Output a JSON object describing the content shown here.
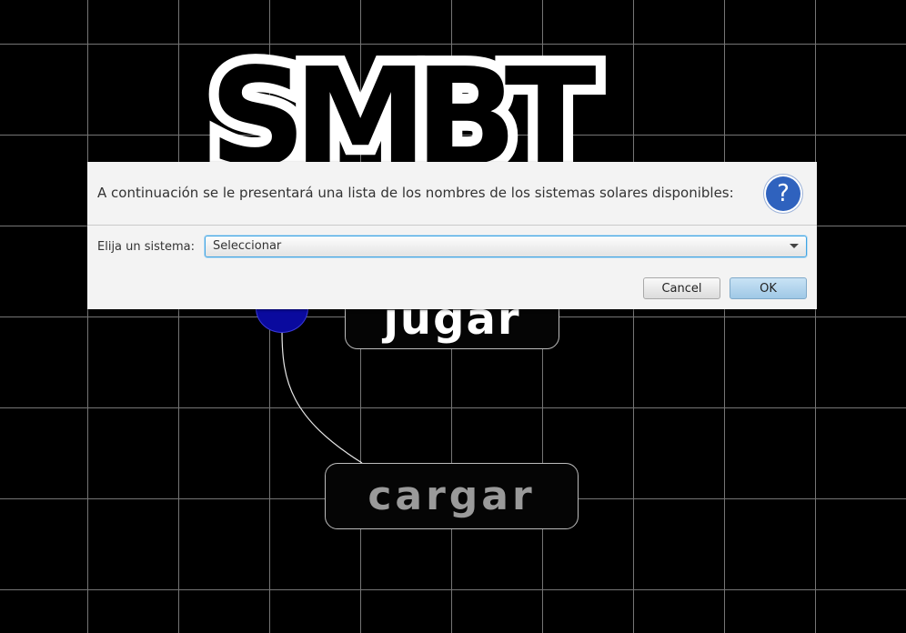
{
  "logo": {
    "text": "SMBT"
  },
  "menu": {
    "play_label": "jugar",
    "load_label": "cargar"
  },
  "dialog": {
    "header_text": "A continuación se le presentará una lista de los nombres de los sistemas solares disponibles:",
    "help_glyph": "?",
    "choice_label": "Elija un sistema:",
    "combo_value": "Seleccionar",
    "cancel_label": "Cancel",
    "ok_label": "OK"
  },
  "icons": {
    "help": "question-mark-icon",
    "dropdown": "chevron-down-icon"
  },
  "colors": {
    "background": "#000000",
    "grid": "#8a8a8a",
    "node": "#0a0a9e",
    "dialog_bg": "#f3f3f3",
    "help_icon": "#2f62be",
    "focus": "#3fa4e3"
  }
}
